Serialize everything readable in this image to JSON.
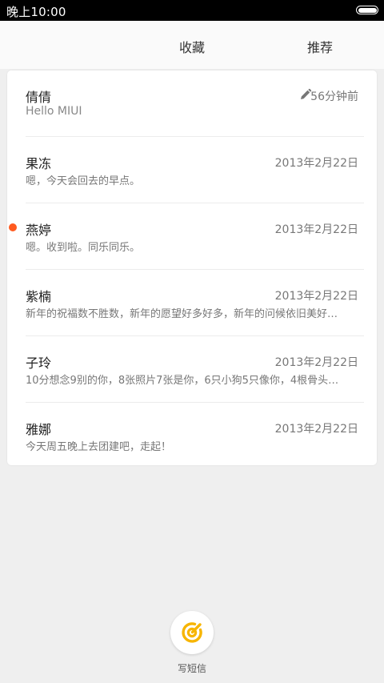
{
  "status_bar": {
    "time": "晚上10:00"
  },
  "tabs": [
    {
      "label": "收藏"
    },
    {
      "label": "推荐"
    }
  ],
  "conversations": [
    {
      "name": "倩倩",
      "preview": "Hello MIUI",
      "date": "56分钟前",
      "draft": true
    },
    {
      "name": "果冻",
      "preview": "嗯，今天会回去的早点。",
      "date": "2013年2月22日"
    },
    {
      "name": "燕婷",
      "preview": "嗯。收到啦。同乐同乐。",
      "date": "2013年2月22日",
      "unread": true
    },
    {
      "name": "紫楠",
      "preview": "新年的祝福数不胜数，新年的愿望好多好多，新年的问候依旧美好…",
      "date": "2013年2月22日"
    },
    {
      "name": "子玲",
      "preview": "10分想念9别的你，8张照片7张是你，6只小狗5只像你，4根骨头…",
      "date": "2013年2月22日"
    },
    {
      "name": "雅娜",
      "preview": "今天周五晚上去团建吧，走起！",
      "date": "2013年2月22日"
    }
  ],
  "compose": {
    "label": "写短信"
  },
  "colors": {
    "accent": "#ff5a1f",
    "compose_icon": "#f7b500"
  }
}
